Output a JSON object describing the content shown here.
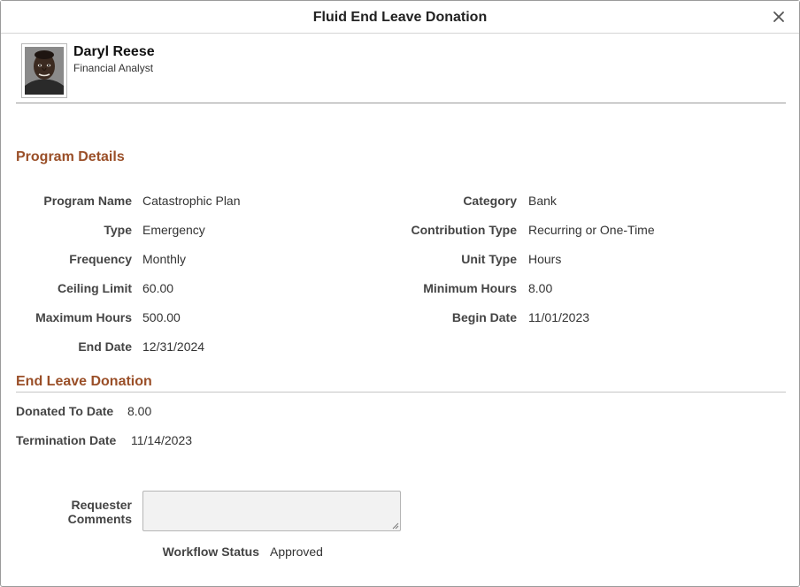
{
  "dialog": {
    "title": "Fluid End Leave Donation",
    "close_icon": "close-icon"
  },
  "employee": {
    "name": "Daryl Reese",
    "job_title": "Financial Analyst"
  },
  "program_details": {
    "heading": "Program Details",
    "left": [
      {
        "label": "Program Name",
        "value": "Catastrophic Plan"
      },
      {
        "label": "Type",
        "value": "Emergency"
      },
      {
        "label": "Frequency",
        "value": "Monthly"
      },
      {
        "label": "Ceiling Limit",
        "value": "60.00"
      },
      {
        "label": "Maximum Hours",
        "value": "500.00"
      },
      {
        "label": "End Date",
        "value": "12/31/2024"
      }
    ],
    "right": [
      {
        "label": "Category",
        "value": "Bank"
      },
      {
        "label": "Contribution Type",
        "value": "Recurring or One-Time"
      },
      {
        "label": "Unit Type",
        "value": "Hours"
      },
      {
        "label": "Minimum Hours",
        "value": "8.00"
      },
      {
        "label": "Begin Date",
        "value": "11/01/2023"
      }
    ]
  },
  "end_leave_donation": {
    "heading": "End Leave Donation",
    "donated_to_date": {
      "label": "Donated To Date",
      "value": "8.00"
    },
    "termination_date": {
      "label": "Termination Date",
      "value": "11/14/2023"
    }
  },
  "requester_comments": {
    "label_line1": "Requester",
    "label_line2": "Comments",
    "value": ""
  },
  "workflow_status": {
    "label": "Workflow Status",
    "value": "Approved"
  },
  "colors": {
    "section_heading": "#9a4f28",
    "divider": "#9a9a9a"
  }
}
